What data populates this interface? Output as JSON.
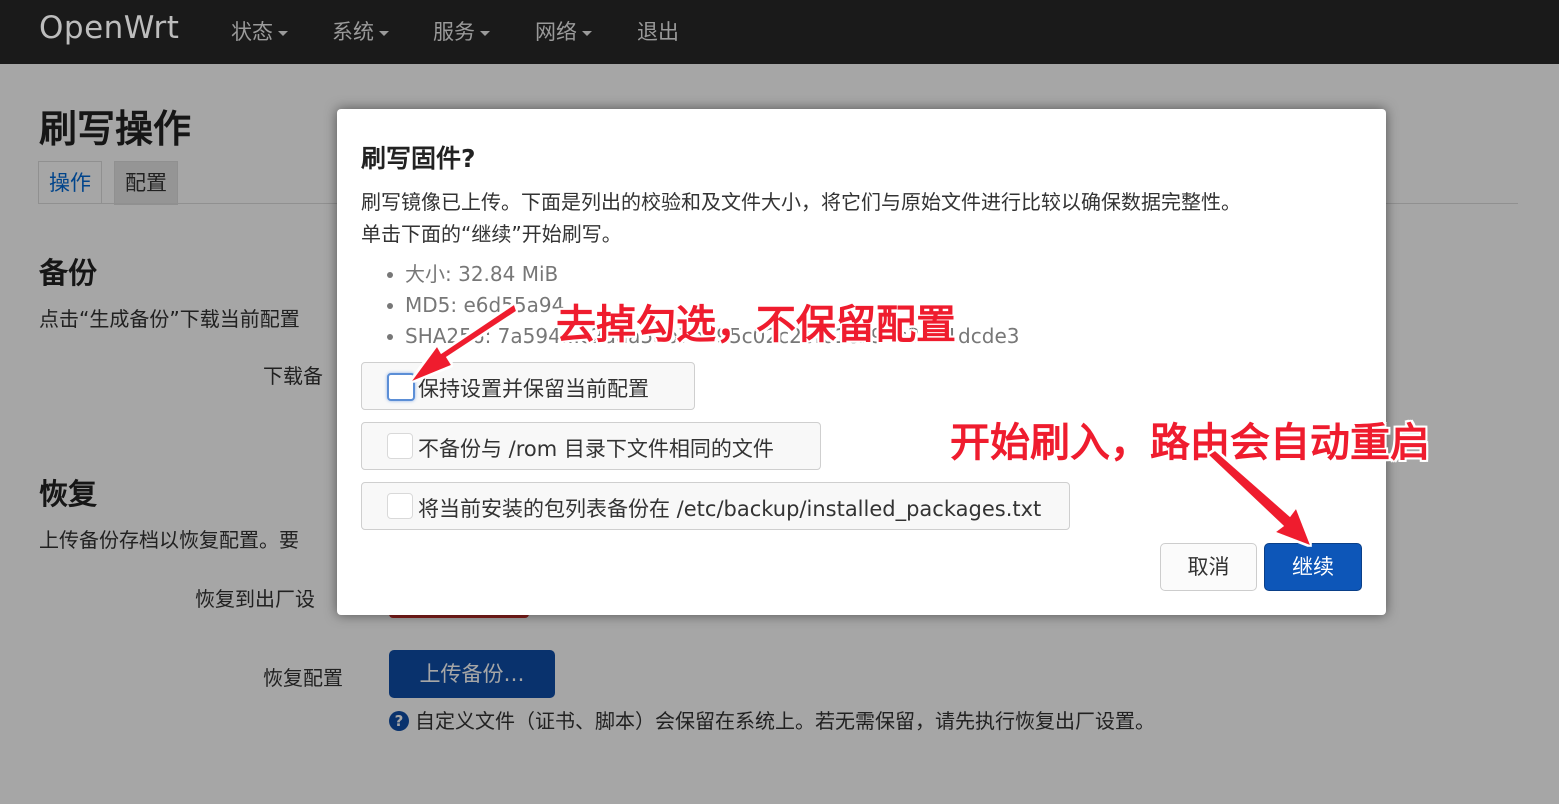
{
  "navbar": {
    "brand": "OpenWrt",
    "items": [
      {
        "label": "状态",
        "has_dropdown": true
      },
      {
        "label": "系统",
        "has_dropdown": true
      },
      {
        "label": "服务",
        "has_dropdown": true
      },
      {
        "label": "网络",
        "has_dropdown": true
      },
      {
        "label": "退出",
        "has_dropdown": false
      }
    ]
  },
  "page": {
    "title": "刷写操作",
    "tabs": [
      {
        "label": "操作",
        "active": true
      },
      {
        "label": "配置",
        "active": false
      }
    ],
    "backup": {
      "title": "备份",
      "description": "点击“生成备份”下载当前配置",
      "download_label": "下载备"
    },
    "restore": {
      "title": "恢复",
      "description": "上传备份存档以恢复配置。要",
      "reset_label": "恢复到出厂设",
      "restore_label": "恢复配置",
      "upload_button": "上传备份…",
      "help_text": "自定义文件（证书、脚本）会保留在系统上。若无需保留，请先执行恢复出厂设置。"
    }
  },
  "modal": {
    "title": "刷写固件?",
    "line1": "刷写镜像已上传。下面是列出的校验和及文件大小，将它们与原始文件进行比较以确保数据完整性。",
    "line2": "单击下面的“继续”开始刷写。",
    "checksums": [
      {
        "label": "大小: 32.84 MiB"
      },
      {
        "label": "MD5: e6d55a94..."
      },
      {
        "label": "SHA256: 7a594...c2aaa5ab7b695c02c2bf61cb94c3421dcde3"
      }
    ],
    "options": [
      {
        "label": "保持设置并保留当前配置",
        "checked": false
      },
      {
        "label": "不备份与 /rom 目录下文件相同的文件",
        "checked": false
      },
      {
        "label": "将当前安装的包列表备份在 /etc/backup/installed_packages.txt",
        "checked": false
      }
    ],
    "cancel_label": "取消",
    "continue_label": "继续"
  },
  "annotations": {
    "uncheck_note": "去掉勾选，不保留配置",
    "flash_note": "开始刷入，路由会自动重启",
    "color": "#ef1c2e"
  },
  "colors": {
    "primary": "#0d56b8",
    "navbar": "#1a1a1a",
    "tab_active_text": "#0069d6"
  }
}
